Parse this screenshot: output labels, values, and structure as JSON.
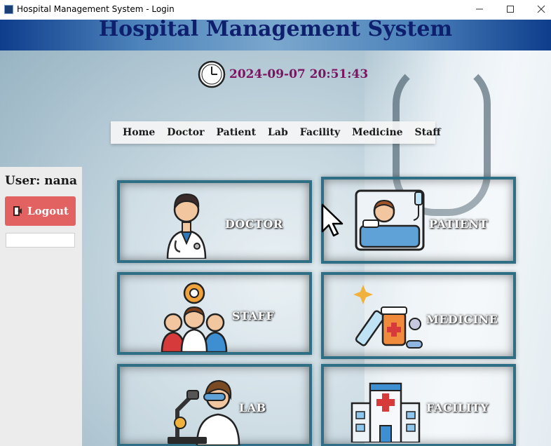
{
  "window": {
    "title": "Hospital Management System - Login",
    "controls": [
      "minimize",
      "maximize",
      "close"
    ]
  },
  "header": {
    "title": "Hospital Management System",
    "datetime": "2024-09-07 20:51:43",
    "clock_icon": "clock-icon"
  },
  "menu": [
    {
      "label": "Home"
    },
    {
      "label": "Doctor"
    },
    {
      "label": "Patient"
    },
    {
      "label": "Lab"
    },
    {
      "label": "Facility"
    },
    {
      "label": "Medicine"
    },
    {
      "label": "Staff"
    }
  ],
  "sidebar": {
    "user_label": "User: nana",
    "logout_label": "Logout",
    "logout_icon": "exit-door-icon",
    "input_value": ""
  },
  "cards": {
    "doctor": {
      "label": "DOCTOR",
      "icon": "doctor-icon"
    },
    "patient": {
      "label": "PATIENT",
      "icon": "patient-bed-icon"
    },
    "staff": {
      "label": "STAFF",
      "icon": "staff-group-icon"
    },
    "medicine": {
      "label": "MEDICINE",
      "icon": "medicine-syringe-icon"
    },
    "lab": {
      "label": "LAB",
      "icon": "lab-scientist-icon"
    },
    "facility": {
      "label": "FACILITY",
      "icon": "hospital-building-icon"
    }
  },
  "colors": {
    "banner_title": "#0e1f6e",
    "datetime": "#7a1561",
    "logout_button": "#e26161",
    "card_border": "#2e6f86"
  }
}
